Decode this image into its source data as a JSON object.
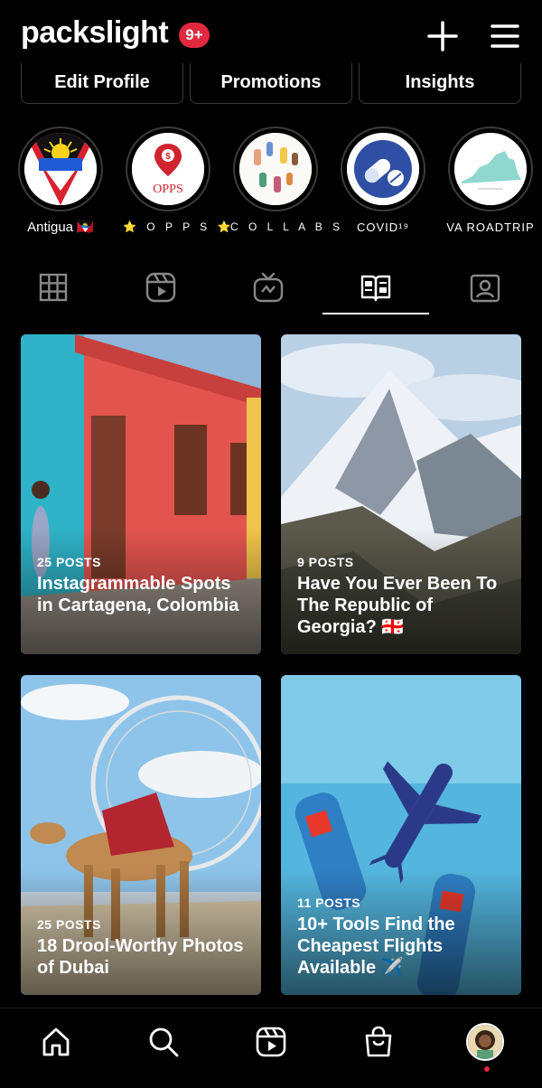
{
  "header": {
    "username": "packslight",
    "notifications": "9+",
    "add_icon": "plus-icon",
    "menu_icon": "menu-icon"
  },
  "actions": {
    "edit_profile": "Edit Profile",
    "promotions": "Promotions",
    "insights": "Insights"
  },
  "highlights": [
    {
      "label": "Antigua 🇦🇬"
    },
    {
      "label": "⭐ O P P S ⭐",
      "image_text": "OPPS"
    },
    {
      "label": "C O L L A B S"
    },
    {
      "label": "COVID¹⁹"
    },
    {
      "label": "VA ROADTRIP"
    }
  ],
  "tabs": [
    {
      "icon": "grid-icon"
    },
    {
      "icon": "reels-icon"
    },
    {
      "icon": "igtv-icon"
    },
    {
      "icon": "guides-icon",
      "active": true
    },
    {
      "icon": "tagged-icon"
    }
  ],
  "guides": [
    {
      "count": "25 POSTS",
      "title": "Instagrammable Spots in Cartagena, Colombia"
    },
    {
      "count": "9 POSTS",
      "title": "Have You Ever Been To The Republic of Georgia? 🇬🇪"
    },
    {
      "count": "25 POSTS",
      "title": "18 Drool-Worthy Photos of Dubai"
    },
    {
      "count": "11 POSTS",
      "title": "10+ Tools Find the Cheapest Flights Available ✈️"
    }
  ],
  "bottom_nav": [
    {
      "icon": "home-icon"
    },
    {
      "icon": "search-icon"
    },
    {
      "icon": "reels-icon"
    },
    {
      "icon": "shop-icon"
    },
    {
      "icon": "profile-avatar"
    }
  ],
  "colors": {
    "background": "#000000",
    "badge": "#e0283f",
    "border": "#3a3a3a"
  }
}
